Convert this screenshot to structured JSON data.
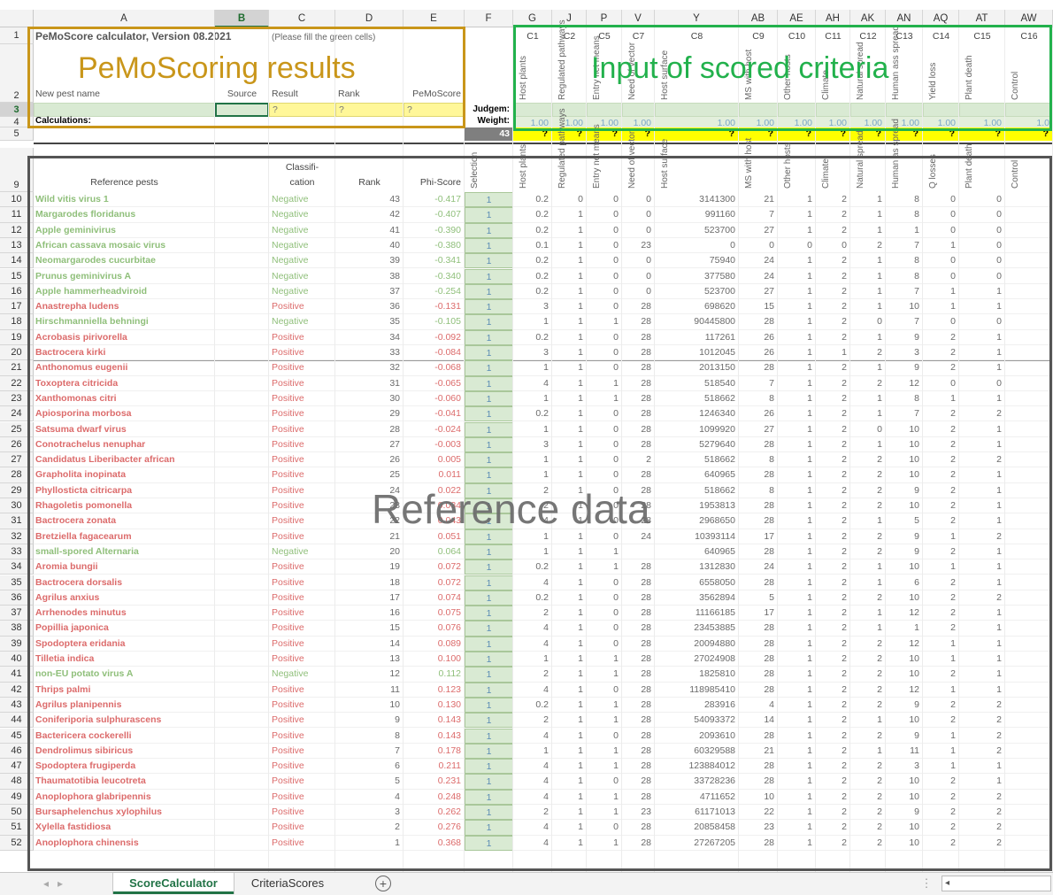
{
  "columns": [
    "A",
    "B",
    "C",
    "D",
    "E",
    "F",
    "G",
    "J",
    "P",
    "V",
    "Y",
    "AB",
    "AE",
    "AH",
    "AK",
    "AN",
    "AQ",
    "AT",
    "AW"
  ],
  "selected_column": "B",
  "selected_row": "3",
  "title": "PeMoScore calculator, Version 08.2021",
  "title_note": "(Please fill the green cells)",
  "headers_row2": {
    "new_pest": "New pest name",
    "source": "Source",
    "result": "Result",
    "rank": "Rank",
    "pemoscore": "PeMoScore"
  },
  "row3_placeholders": [
    "?",
    "?",
    "?"
  ],
  "row3_label": "Judgem:",
  "row4_label": "Calculations:",
  "row4_weight_label": "Weight:",
  "row5_value": "43",
  "row5_marks": "?",
  "criteria_codes": [
    "C1",
    "C2",
    "C5",
    "C7",
    "C8",
    "C9",
    "C10",
    "C11",
    "C12",
    "C13",
    "C14",
    "C15",
    "C16"
  ],
  "criteria_names_top": [
    "Host plants",
    "Regulated pathways",
    "Entry net means",
    "Need of vector",
    "Host surface",
    "MS with host",
    "Other hosts",
    "Climate",
    "Natural spread",
    "Human ass spread",
    "Yield loss",
    "Plant death",
    "Control"
  ],
  "weights": [
    "1.00",
    "1.00",
    "1.00",
    "1.00",
    "1.00",
    "1.00",
    "1.00",
    "1.00",
    "1.00",
    "1.00",
    "1.00",
    "1.00",
    "1.0"
  ],
  "ref_headers": {
    "reference_pests": "Reference pests",
    "classification": "Classifi-\ncation",
    "rank": "Rank",
    "phi": "Phi-Score",
    "selection": "Selection"
  },
  "criteria_names_ref": [
    "Host plants",
    "Regulated pathways",
    "Entry net means",
    "Need of vector",
    "Host surface",
    "MS with host",
    "Other hosts",
    "Climate",
    "Natural spread",
    "Human as spread",
    "Q losses",
    "Plant death",
    "Control"
  ],
  "rows": [
    {
      "n": "10",
      "name": "Wild vitis virus 1",
      "cls": "Negative",
      "rank": "43",
      "phi": "-0.417",
      "sel": "1",
      "v": [
        "0.2",
        "0",
        "0",
        "0",
        "3141300",
        "21",
        "1",
        "2",
        "1",
        "8",
        "0",
        "0"
      ]
    },
    {
      "n": "11",
      "name": "Margarodes floridanus",
      "cls": "Negative",
      "rank": "42",
      "phi": "-0.407",
      "sel": "1",
      "v": [
        "0.2",
        "1",
        "0",
        "0",
        "991160",
        "7",
        "1",
        "2",
        "1",
        "8",
        "0",
        "0"
      ]
    },
    {
      "n": "12",
      "name": "Apple geminivirus",
      "cls": "Negative",
      "rank": "41",
      "phi": "-0.390",
      "sel": "1",
      "v": [
        "0.2",
        "1",
        "0",
        "0",
        "523700",
        "27",
        "1",
        "2",
        "1",
        "1",
        "0",
        "0"
      ]
    },
    {
      "n": "13",
      "name": "African cassava mosaic virus",
      "cls": "Negative",
      "rank": "40",
      "phi": "-0.380",
      "sel": "1",
      "v": [
        "0.1",
        "1",
        "0",
        "23",
        "0",
        "0",
        "0",
        "0",
        "2",
        "7",
        "1",
        "0"
      ]
    },
    {
      "n": "14",
      "name": "Neomargarodes cucurbitae",
      "cls": "Negative",
      "rank": "39",
      "phi": "-0.341",
      "sel": "1",
      "v": [
        "0.2",
        "1",
        "0",
        "0",
        "75940",
        "24",
        "1",
        "2",
        "1",
        "8",
        "0",
        "0"
      ]
    },
    {
      "n": "15",
      "name": "Prunus geminivirus A",
      "cls": "Negative",
      "rank": "38",
      "phi": "-0.340",
      "sel": "1",
      "v": [
        "0.2",
        "1",
        "0",
        "0",
        "377580",
        "24",
        "1",
        "2",
        "1",
        "8",
        "0",
        "0"
      ]
    },
    {
      "n": "16",
      "name": "Apple hammerheadviroid",
      "cls": "Negative",
      "rank": "37",
      "phi": "-0.254",
      "sel": "1",
      "v": [
        "0.2",
        "1",
        "0",
        "0",
        "523700",
        "27",
        "1",
        "2",
        "1",
        "7",
        "1",
        "1"
      ]
    },
    {
      "n": "17",
      "name": "Anastrepha ludens",
      "cls": "Positive",
      "rank": "36",
      "phi": "-0.131",
      "sel": "1",
      "v": [
        "3",
        "1",
        "0",
        "28",
        "698620",
        "15",
        "1",
        "2",
        "1",
        "10",
        "1",
        "1"
      ]
    },
    {
      "n": "18",
      "name": "Hirschmanniella behningi",
      "cls": "Negative",
      "rank": "35",
      "phi": "-0.105",
      "sel": "1",
      "v": [
        "1",
        "1",
        "1",
        "28",
        "90445800",
        "28",
        "1",
        "2",
        "0",
        "7",
        "0",
        "0"
      ]
    },
    {
      "n": "19",
      "name": "Acrobasis pirivorella",
      "cls": "Positive",
      "rank": "34",
      "phi": "-0.092",
      "sel": "1",
      "v": [
        "0.2",
        "1",
        "0",
        "28",
        "117261",
        "26",
        "1",
        "2",
        "1",
        "9",
        "2",
        "1"
      ]
    },
    {
      "n": "20",
      "name": "Bactrocera kirki",
      "cls": "Positive",
      "rank": "33",
      "phi": "-0.084",
      "sel": "1",
      "v": [
        "3",
        "1",
        "0",
        "28",
        "1012045",
        "26",
        "1",
        "1",
        "2",
        "3",
        "2",
        "1"
      ]
    },
    {
      "n": "21",
      "name": "Anthonomus eugenii",
      "cls": "Positive",
      "rank": "32",
      "phi": "-0.068",
      "sel": "1",
      "v": [
        "1",
        "1",
        "0",
        "28",
        "2013150",
        "28",
        "1",
        "2",
        "1",
        "9",
        "2",
        "1"
      ]
    },
    {
      "n": "22",
      "name": "Toxoptera citricida",
      "cls": "Positive",
      "rank": "31",
      "phi": "-0.065",
      "sel": "1",
      "v": [
        "4",
        "1",
        "1",
        "28",
        "518540",
        "7",
        "1",
        "2",
        "2",
        "12",
        "0",
        "0"
      ]
    },
    {
      "n": "23",
      "name": "Xanthomonas citri",
      "cls": "Positive",
      "rank": "30",
      "phi": "-0.060",
      "sel": "1",
      "v": [
        "1",
        "1",
        "1",
        "28",
        "518662",
        "8",
        "1",
        "2",
        "1",
        "8",
        "1",
        "1"
      ]
    },
    {
      "n": "24",
      "name": "Apiosporina morbosa",
      "cls": "Positive",
      "rank": "29",
      "phi": "-0.041",
      "sel": "1",
      "v": [
        "0.2",
        "1",
        "0",
        "28",
        "1246340",
        "26",
        "1",
        "2",
        "1",
        "7",
        "2",
        "2"
      ]
    },
    {
      "n": "25",
      "name": "Satsuma dwarf virus",
      "cls": "Positive",
      "rank": "28",
      "phi": "-0.024",
      "sel": "1",
      "v": [
        "1",
        "1",
        "0",
        "28",
        "1099920",
        "27",
        "1",
        "2",
        "0",
        "10",
        "2",
        "1"
      ]
    },
    {
      "n": "26",
      "name": "Conotrachelus nenuphar",
      "cls": "Positive",
      "rank": "27",
      "phi": "-0.003",
      "sel": "1",
      "v": [
        "3",
        "1",
        "0",
        "28",
        "5279640",
        "28",
        "1",
        "2",
        "1",
        "10",
        "2",
        "1"
      ]
    },
    {
      "n": "27",
      "name": "Candidatus Liberibacter african",
      "cls": "Positive",
      "rank": "26",
      "phi": "0.005",
      "sel": "1",
      "v": [
        "1",
        "1",
        "0",
        "2",
        "518662",
        "8",
        "1",
        "2",
        "2",
        "10",
        "2",
        "2"
      ]
    },
    {
      "n": "28",
      "name": "Grapholita inopinata",
      "cls": "Positive",
      "rank": "25",
      "phi": "0.011",
      "sel": "1",
      "v": [
        "1",
        "1",
        "0",
        "28",
        "640965",
        "28",
        "1",
        "2",
        "2",
        "10",
        "2",
        "1"
      ]
    },
    {
      "n": "29",
      "name": "Phyllosticta citricarpa",
      "cls": "Positive",
      "rank": "24",
      "phi": "0.022",
      "sel": "1",
      "v": [
        "2",
        "1",
        "0",
        "28",
        "518662",
        "8",
        "1",
        "2",
        "2",
        "9",
        "2",
        "1"
      ]
    },
    {
      "n": "30",
      "name": "Rhagoletis pomonella",
      "cls": "Positive",
      "rank": "23",
      "phi": "0.034",
      "sel": "1",
      "v": [
        "2",
        "1",
        "0",
        "28",
        "1953813",
        "28",
        "1",
        "2",
        "2",
        "10",
        "2",
        "1"
      ]
    },
    {
      "n": "31",
      "name": "Bactrocera zonata",
      "cls": "Positive",
      "rank": "22",
      "phi": "0.043",
      "sel": "1",
      "v": [
        "4",
        "1",
        "0",
        "28",
        "2968650",
        "28",
        "1",
        "2",
        "1",
        "5",
        "2",
        "1"
      ]
    },
    {
      "n": "32",
      "name": "Bretziella fagacearum",
      "cls": "Positive",
      "rank": "21",
      "phi": "0.051",
      "sel": "1",
      "v": [
        "1",
        "1",
        "0",
        "24",
        "10393114",
        "17",
        "1",
        "2",
        "2",
        "9",
        "1",
        "2"
      ]
    },
    {
      "n": "33",
      "name": "small-spored Alternaria",
      "cls": "Negative",
      "rank": "20",
      "phi": "0.064",
      "sel": "1",
      "v": [
        "1",
        "1",
        "1",
        "",
        "640965",
        "28",
        "1",
        "2",
        "2",
        "9",
        "2",
        "1"
      ]
    },
    {
      "n": "34",
      "name": "Aromia bungii",
      "cls": "Positive",
      "rank": "19",
      "phi": "0.072",
      "sel": "1",
      "v": [
        "0.2",
        "1",
        "1",
        "28",
        "1312830",
        "24",
        "1",
        "2",
        "1",
        "10",
        "1",
        "1"
      ]
    },
    {
      "n": "35",
      "name": "Bactrocera dorsalis",
      "cls": "Positive",
      "rank": "18",
      "phi": "0.072",
      "sel": "1",
      "v": [
        "4",
        "1",
        "0",
        "28",
        "6558050",
        "28",
        "1",
        "2",
        "1",
        "6",
        "2",
        "1"
      ]
    },
    {
      "n": "36",
      "name": "Agrilus anxius",
      "cls": "Positive",
      "rank": "17",
      "phi": "0.074",
      "sel": "1",
      "v": [
        "0.2",
        "1",
        "0",
        "28",
        "3562894",
        "5",
        "1",
        "2",
        "2",
        "10",
        "2",
        "2"
      ]
    },
    {
      "n": "37",
      "name": "Arrhenodes minutus",
      "cls": "Positive",
      "rank": "16",
      "phi": "0.075",
      "sel": "1",
      "v": [
        "2",
        "1",
        "0",
        "28",
        "11166185",
        "17",
        "1",
        "2",
        "1",
        "12",
        "2",
        "1"
      ]
    },
    {
      "n": "38",
      "name": "Popillia japonica",
      "cls": "Positive",
      "rank": "15",
      "phi": "0.076",
      "sel": "1",
      "v": [
        "4",
        "1",
        "0",
        "28",
        "23453885",
        "28",
        "1",
        "2",
        "1",
        "1",
        "2",
        "1"
      ]
    },
    {
      "n": "39",
      "name": "Spodoptera eridania",
      "cls": "Positive",
      "rank": "14",
      "phi": "0.089",
      "sel": "1",
      "v": [
        "4",
        "1",
        "0",
        "28",
        "20094880",
        "28",
        "1",
        "2",
        "2",
        "12",
        "1",
        "1"
      ]
    },
    {
      "n": "40",
      "name": "Tilletia indica",
      "cls": "Positive",
      "rank": "13",
      "phi": "0.100",
      "sel": "1",
      "v": [
        "1",
        "1",
        "1",
        "28",
        "27024908",
        "28",
        "1",
        "2",
        "2",
        "10",
        "1",
        "1"
      ]
    },
    {
      "n": "41",
      "name": "non-EU potato virus A",
      "cls": "Negative",
      "rank": "12",
      "phi": "0.112",
      "sel": "1",
      "v": [
        "2",
        "1",
        "1",
        "28",
        "1825810",
        "28",
        "1",
        "2",
        "2",
        "10",
        "2",
        "1"
      ]
    },
    {
      "n": "42",
      "name": "Thrips palmi",
      "cls": "Positive",
      "rank": "11",
      "phi": "0.123",
      "sel": "1",
      "v": [
        "4",
        "1",
        "0",
        "28",
        "118985410",
        "28",
        "1",
        "2",
        "2",
        "12",
        "1",
        "1"
      ]
    },
    {
      "n": "43",
      "name": "Agrilus planipennis",
      "cls": "Positive",
      "rank": "10",
      "phi": "0.130",
      "sel": "1",
      "v": [
        "0.2",
        "1",
        "1",
        "28",
        "283916",
        "4",
        "1",
        "2",
        "2",
        "9",
        "2",
        "2"
      ]
    },
    {
      "n": "44",
      "name": "Coniferiporia sulphurascens",
      "cls": "Positive",
      "rank": "9",
      "phi": "0.143",
      "sel": "1",
      "v": [
        "2",
        "1",
        "1",
        "28",
        "54093372",
        "14",
        "1",
        "2",
        "1",
        "10",
        "2",
        "2"
      ]
    },
    {
      "n": "45",
      "name": "Bactericera cockerelli",
      "cls": "Positive",
      "rank": "8",
      "phi": "0.143",
      "sel": "1",
      "v": [
        "4",
        "1",
        "0",
        "28",
        "2093610",
        "28",
        "1",
        "2",
        "2",
        "9",
        "1",
        "2"
      ]
    },
    {
      "n": "46",
      "name": "Dendrolimus sibiricus",
      "cls": "Positive",
      "rank": "7",
      "phi": "0.178",
      "sel": "1",
      "v": [
        "1",
        "1",
        "1",
        "28",
        "60329588",
        "21",
        "1",
        "2",
        "1",
        "11",
        "1",
        "2"
      ]
    },
    {
      "n": "47",
      "name": "Spodoptera frugiperda",
      "cls": "Positive",
      "rank": "6",
      "phi": "0.211",
      "sel": "1",
      "v": [
        "4",
        "1",
        "1",
        "28",
        "123884012",
        "28",
        "1",
        "2",
        "2",
        "3",
        "1",
        "1"
      ]
    },
    {
      "n": "48",
      "name": "Thaumatotibia leucotreta",
      "cls": "Positive",
      "rank": "5",
      "phi": "0.231",
      "sel": "1",
      "v": [
        "4",
        "1",
        "0",
        "28",
        "33728236",
        "28",
        "1",
        "2",
        "2",
        "10",
        "2",
        "1"
      ]
    },
    {
      "n": "49",
      "name": "Anoplophora glabripennis",
      "cls": "Positive",
      "rank": "4",
      "phi": "0.248",
      "sel": "1",
      "v": [
        "4",
        "1",
        "1",
        "28",
        "4711652",
        "10",
        "1",
        "2",
        "2",
        "10",
        "2",
        "2"
      ]
    },
    {
      "n": "50",
      "name": "Bursaphelenchus xylophilus",
      "cls": "Positive",
      "rank": "3",
      "phi": "0.262",
      "sel": "1",
      "v": [
        "2",
        "1",
        "1",
        "23",
        "61171013",
        "22",
        "1",
        "2",
        "2",
        "9",
        "2",
        "2"
      ]
    },
    {
      "n": "51",
      "name": "Xylella fastidiosa",
      "cls": "Positive",
      "rank": "2",
      "phi": "0.276",
      "sel": "1",
      "v": [
        "4",
        "1",
        "0",
        "28",
        "20858458",
        "23",
        "1",
        "2",
        "2",
        "10",
        "2",
        "2"
      ]
    },
    {
      "n": "52",
      "name": "Anoplophora chinensis",
      "cls": "Positive",
      "rank": "1",
      "phi": "0.368",
      "sel": "1",
      "v": [
        "4",
        "1",
        "1",
        "28",
        "27267205",
        "28",
        "1",
        "2",
        "2",
        "10",
        "2",
        "2"
      ]
    }
  ],
  "overlay": {
    "results": "PeMoScoring results",
    "criteria": "Input of scored criteria",
    "reference": "Reference data",
    "results_color": "#c9961a",
    "criteria_color": "#22b14c",
    "reference_color": "#555555"
  },
  "tabs": [
    {
      "label": "ScoreCalculator",
      "active": true
    },
    {
      "label": "CriteriaScores",
      "active": false
    }
  ],
  "add_sheet": "+"
}
